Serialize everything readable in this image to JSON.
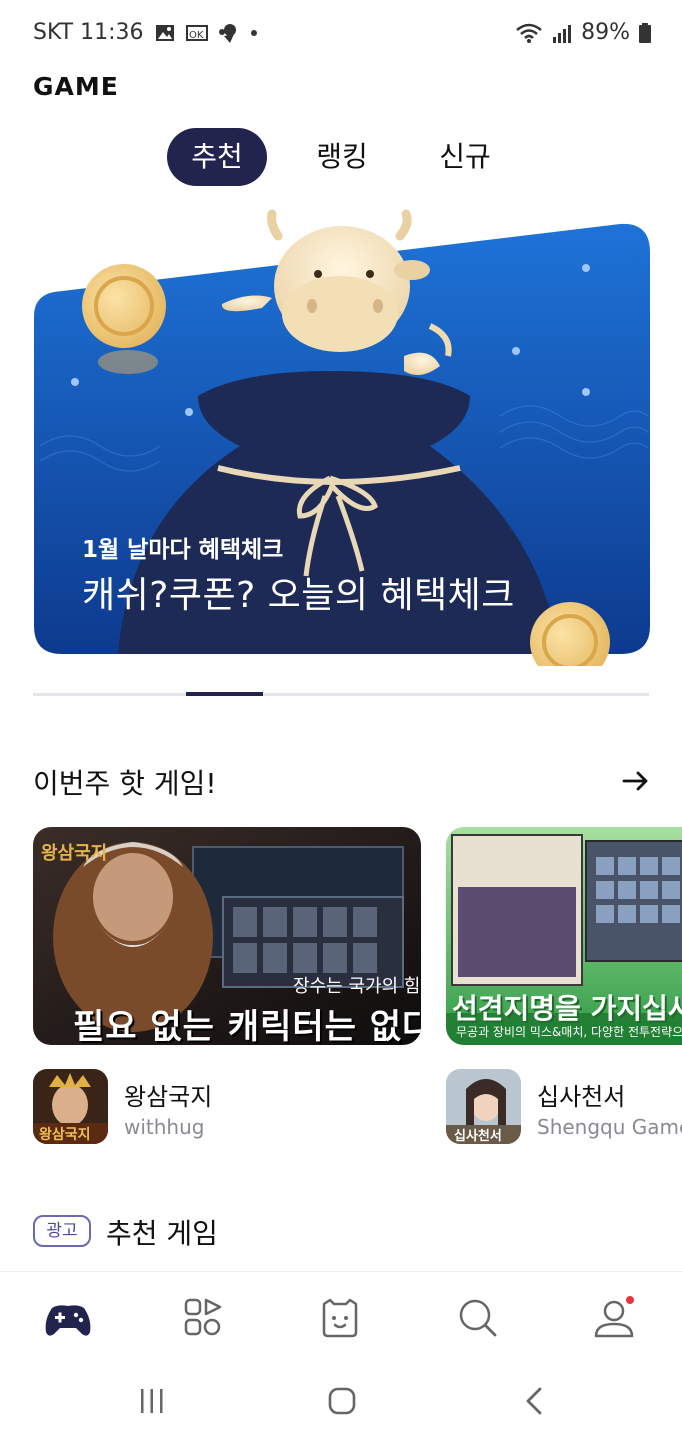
{
  "status_bar": {
    "carrier_time": "SKT 11:36",
    "battery": "89%",
    "icons": [
      "image-icon",
      "ok-icon",
      "pet-icon",
      "dot-icon",
      "wifi-icon",
      "signal-icon",
      "battery-icon"
    ]
  },
  "header": {
    "title": "GAME"
  },
  "tabs": [
    {
      "label": "추천",
      "active": true
    },
    {
      "label": "랭킹",
      "active": false
    },
    {
      "label": "신규",
      "active": false
    }
  ],
  "banner": {
    "subtitle": "1월 날마다 혜택체크",
    "title": "캐쉬?쿠폰? 오늘의 혜택체크",
    "colors": {
      "bg_top": "#1e73d8",
      "bg_bottom": "#0d3a8e",
      "pouch": "#1c2a55"
    }
  },
  "hot_games": {
    "title": "이번주 핫 게임!",
    "arrow_icon": "arrow-right-icon",
    "games": [
      {
        "name": "왕삼국지",
        "developer": "withhug",
        "card_tagline": "장수는 국가의 힘",
        "card_slogan": "필요 없는 캐릭터는 없다"
      },
      {
        "name": "십사천서",
        "developer": "Shengqu Games",
        "card_slogan": "선견지명을 가지십사",
        "card_desc": "무공과 장비의 믹스&매치, 다양한 전투전략으로 승리를"
      }
    ]
  },
  "ad_section": {
    "badge": "광고",
    "title": "추천 게임"
  },
  "bottom_nav": [
    "game-controller-icon",
    "apps-icon",
    "character-icon",
    "search-icon",
    "profile-icon"
  ],
  "accent_color": "#23244d",
  "notification_color": "#e8343c"
}
